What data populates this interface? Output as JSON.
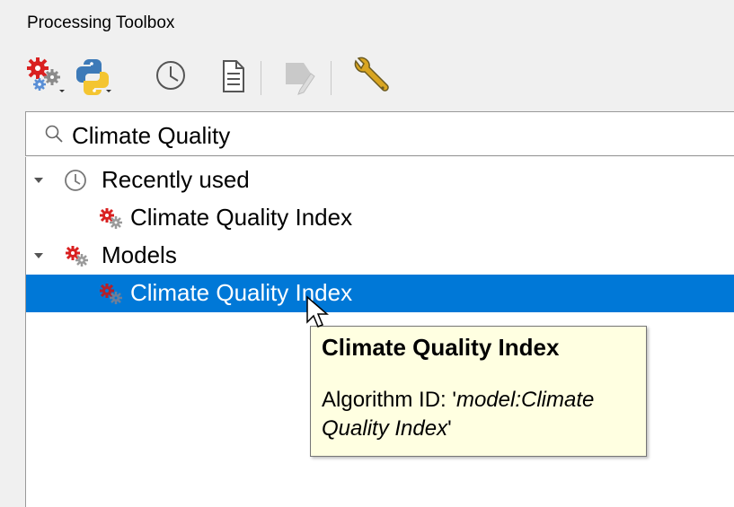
{
  "panel": {
    "title": "Processing Toolbox"
  },
  "toolbar": {
    "items": [
      {
        "icon": "models-gear-icon",
        "has_dropdown": true
      },
      {
        "icon": "python-icon",
        "has_dropdown": true
      },
      {
        "icon": "history-clock-icon"
      },
      {
        "icon": "results-document-icon"
      },
      {
        "icon": "edit-in-place-icon",
        "disabled": true
      },
      {
        "icon": "options-wrench-icon"
      }
    ]
  },
  "search": {
    "value": "Climate Quality",
    "icon": "search-icon"
  },
  "tree": {
    "groups": [
      {
        "label": "Recently used",
        "icon": "clock-icon",
        "expanded": true,
        "children": [
          {
            "label": "Climate Quality Index",
            "icon": "model-gear-icon"
          }
        ]
      },
      {
        "label": "Models",
        "icon": "models-gear-icon",
        "expanded": true,
        "children": [
          {
            "label": "Climate Quality Index",
            "icon": "model-gear-icon",
            "selected": true
          }
        ]
      }
    ]
  },
  "tooltip": {
    "title": "Climate Quality Index",
    "line1_prefix": "Algorithm ID: '",
    "line1_italic": "model:Climate",
    "line2_italic": "Quality Index",
    "line2_suffix": "'"
  },
  "colors": {
    "selection": "#0078d7",
    "tooltip_bg": "#ffffe1",
    "gear_red": "#d92020"
  }
}
